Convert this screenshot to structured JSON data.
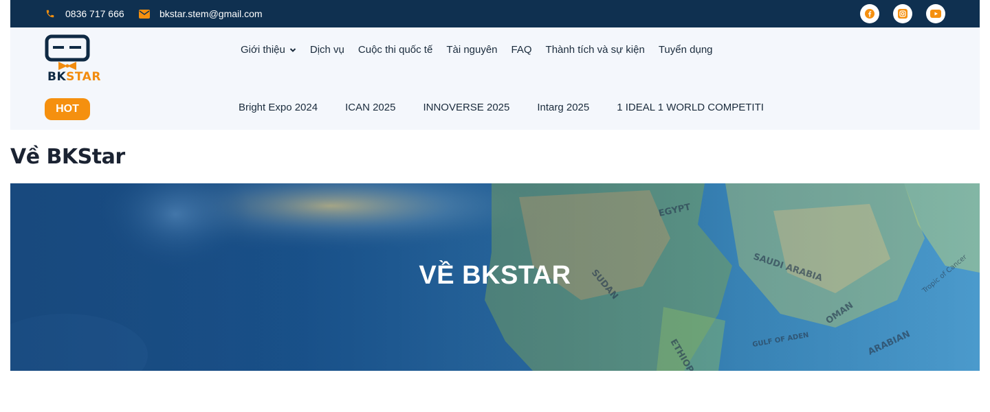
{
  "topbar": {
    "phone": "0836 717 666",
    "email": "bkstar.stem@gmail.com",
    "socials": [
      {
        "icon": "facebook-icon"
      },
      {
        "icon": "instagram-icon"
      },
      {
        "icon": "youtube-icon"
      }
    ]
  },
  "logo": {
    "part1": "BK",
    "part2": "STAR"
  },
  "nav": {
    "items": [
      {
        "label": "Giới thiệu",
        "has_dropdown": true
      },
      {
        "label": "Dịch vụ"
      },
      {
        "label": "Cuộc thi quốc tế"
      },
      {
        "label": "Tài nguyên"
      },
      {
        "label": "FAQ"
      },
      {
        "label": "Thành tích và sự kiện"
      },
      {
        "label": "Tuyển dụng"
      }
    ]
  },
  "hot": {
    "badge": "HOT",
    "items": [
      "Bright Expo 2024",
      "ICAN 2025",
      "INNOVERSE 2025",
      "Intarg 2025",
      "1 IDEAL 1 WORLD COMPETITI"
    ]
  },
  "page": {
    "title": "Về BKStar",
    "banner_title": "VỀ BKSTAR"
  },
  "colors": {
    "topbar": "#0f3050",
    "accent": "#f5900f",
    "header_bg": "#f4f7fc"
  },
  "map_labels": {
    "egypt": "EGYPT",
    "sudan": "SUDAN",
    "saudi": "SAUDI ARABIA",
    "ethiopia": "ETHIOPIA",
    "oman": "OMAN",
    "gulf": "GULF OF ADEN",
    "arabian": "ARABIAN",
    "tropic": "Tropic of Cancer"
  }
}
